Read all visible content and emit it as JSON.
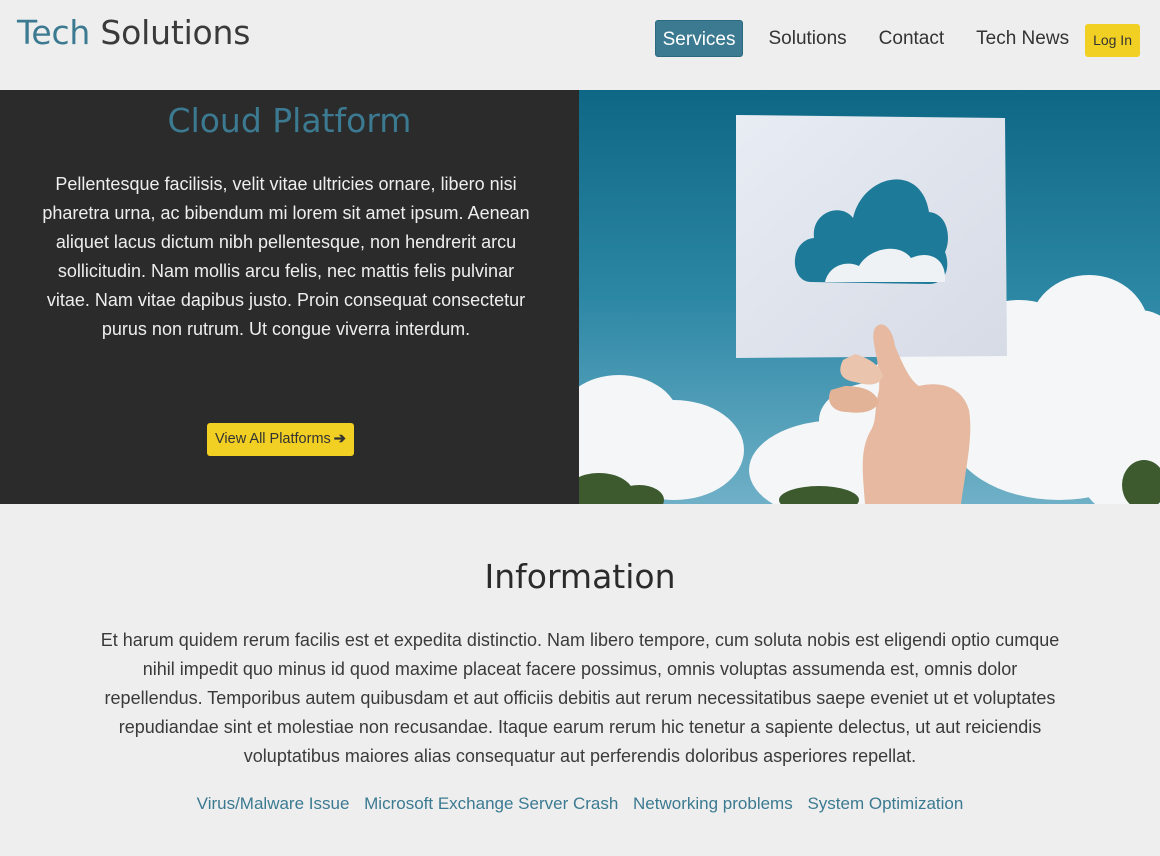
{
  "header": {
    "brand_first": "Tech",
    "brand_second": "Solutions",
    "nav": [
      {
        "label": "Services",
        "active": true
      },
      {
        "label": "Solutions",
        "active": false
      },
      {
        "label": "Contact",
        "active": false
      },
      {
        "label": "Tech News",
        "active": false
      }
    ],
    "login_label": "Log In"
  },
  "hero": {
    "title": "Cloud Platform",
    "text": "Pellentesque facilisis, velit vitae ultricies ornare, libero nisi pharetra urna, ac bibendum mi lorem sit amet ipsum. Aenean aliquet lacus dictum nibh pellentesque, non hendrerit arcu sollicitudin. Nam mollis arcu felis, nec mattis felis pulvinar vitae. Nam vitae dapibus justo. Proin consequat consectetur purus non rutrum. Ut congue viverra interdum.",
    "button_label": "View All Platforms",
    "button_icon": "arrow-right-icon",
    "image": "hand-holding-paper-cloud-cutout-against-sky"
  },
  "info": {
    "title": "Information",
    "text": "Et harum quidem rerum facilis est et expedita distinctio. Nam libero tempore, cum soluta nobis est eligendi optio cumque nihil impedit quo minus id quod maxime placeat facere possimus, omnis voluptas assumenda est, omnis dolor repellendus. Temporibus autem quibusdam et aut officiis debitis aut rerum necessitatibus saepe eveniet ut et voluptates repudiandae sint et molestiae non recusandae. Itaque earum rerum hic tenetur a sapiente delectus, ut aut reiciendis voluptatibus maiores alias consequatur aut perferendis doloribus asperiores repellat.",
    "links": [
      "Virus/Malware Issue",
      "Microsoft Exchange Server Crash",
      "Networking problems",
      "System Optimization"
    ]
  },
  "colors": {
    "accent": "#3b7a91",
    "button": "#f2d023",
    "hero_bg": "#2b2b2b",
    "page_bg": "#eeeeee"
  }
}
